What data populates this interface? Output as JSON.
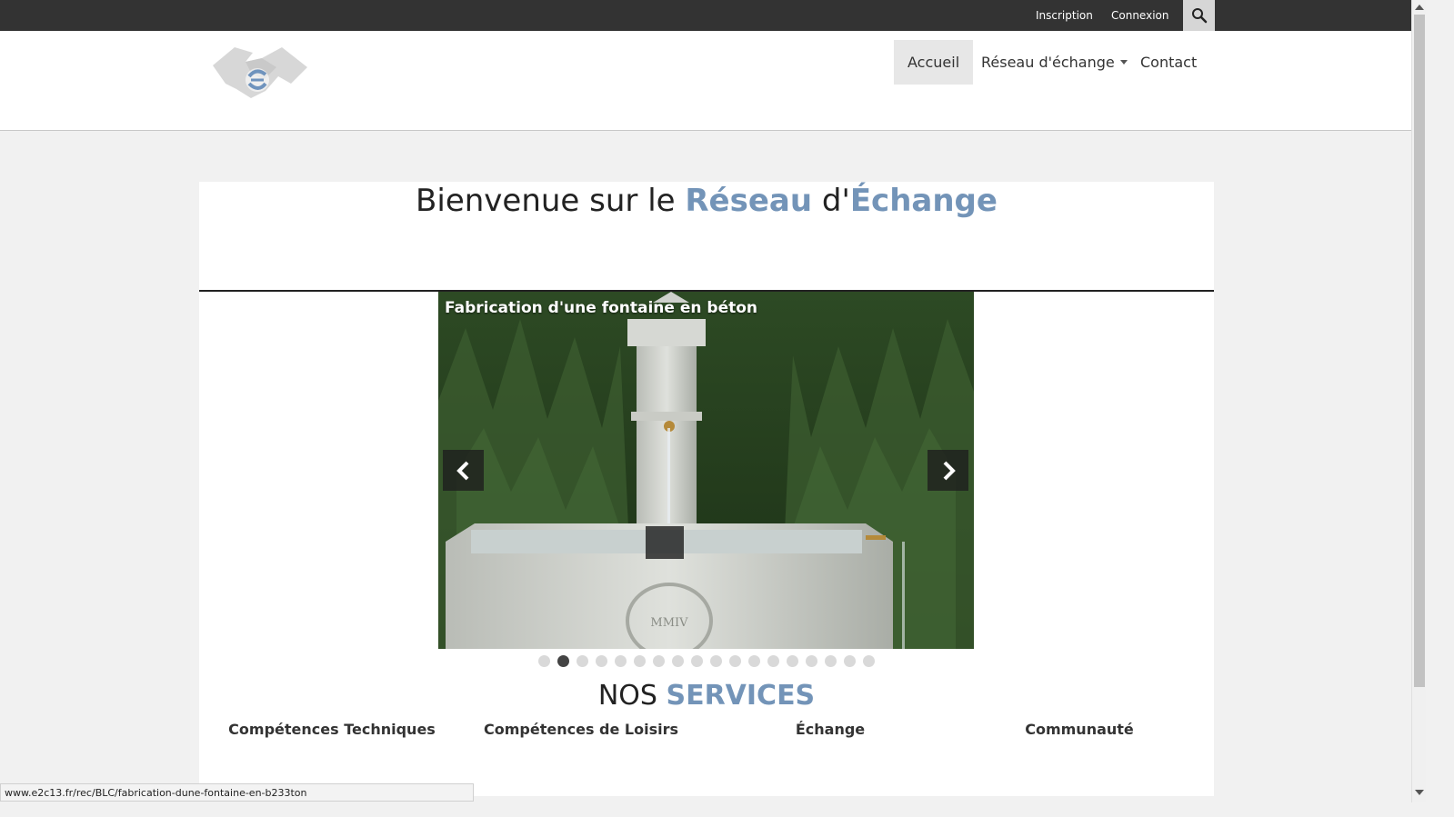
{
  "topbar": {
    "register_label": "Inscription",
    "login_label": "Connexion",
    "search_icon": "search-icon"
  },
  "nav": {
    "items": [
      {
        "label": "Accueil",
        "active": true
      },
      {
        "label": "Réseau d'échange",
        "dropdown": true
      },
      {
        "label": "Contact"
      }
    ]
  },
  "hero": {
    "welcome_prefix": "Bienvenue sur le ",
    "welcome_word1": "Réseau",
    "welcome_mid": " d'",
    "welcome_word2": "Échange"
  },
  "carousel": {
    "slide_title": "Fabrication d'une fontaine en béton",
    "slide_count": 18,
    "active_index": 1,
    "prev_icon": "chevron-left-icon",
    "next_icon": "chevron-right-icon",
    "inscription": "MMIV"
  },
  "services": {
    "title_plain": "NOS ",
    "title_accent": "SERVICES",
    "items": [
      "Compétences Techniques",
      "Compétences de Loisirs",
      "Échange",
      "Communauté"
    ]
  },
  "status_url": "www.e2c13.fr/rec/BLC/fabrication-dune-fontaine-en-b233ton",
  "colors": {
    "accent": "#7394b8",
    "topbar": "#333333",
    "page_bg": "#f1f1f1"
  }
}
